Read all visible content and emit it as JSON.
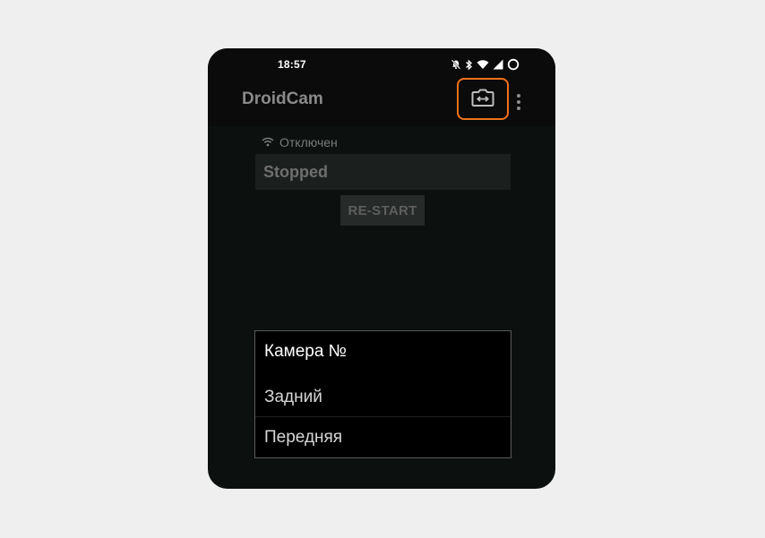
{
  "statusbar": {
    "time": "18:57",
    "icons": [
      "bell-off-icon",
      "bluetooth-icon",
      "wifi-icon",
      "signal-icon",
      "battery-ring-icon"
    ]
  },
  "appbar": {
    "title": "DroidCam",
    "switch_camera_icon": "switch-camera-icon",
    "overflow_icon": "more-vert-icon",
    "highlight_color": "#f0711b"
  },
  "main": {
    "connection_status": "Отключен",
    "state": "Stopped",
    "restart_label": "RE-START"
  },
  "dialog": {
    "title": "Камера №",
    "options": [
      "Задний",
      "Передняя"
    ]
  }
}
